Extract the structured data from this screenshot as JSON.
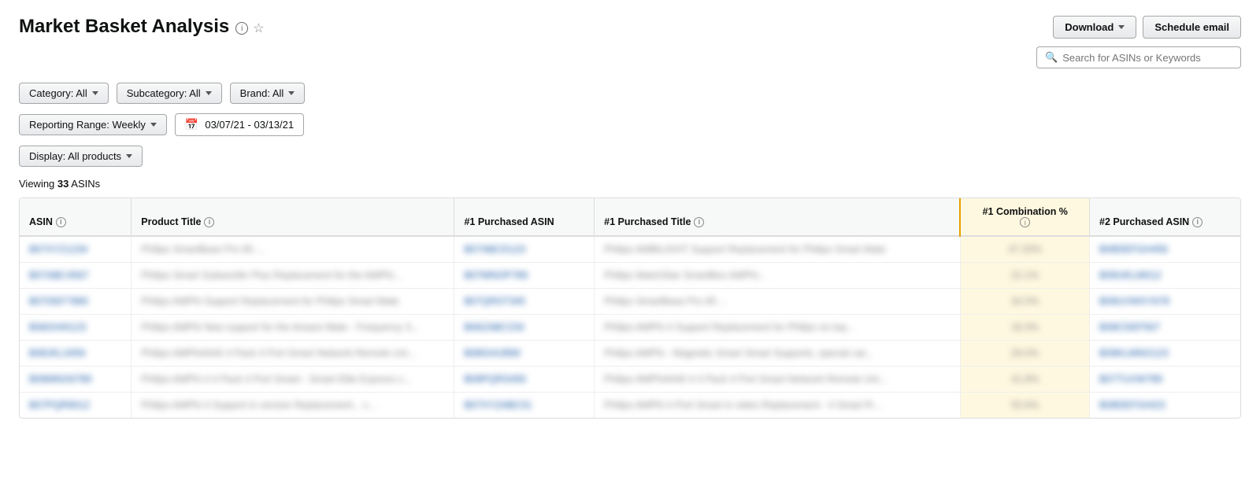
{
  "page": {
    "title": "Market Basket Analysis",
    "info_icon": "i",
    "star_icon": "☆"
  },
  "header": {
    "download_label": "Download",
    "schedule_email_label": "Schedule email",
    "search_placeholder": "Search for ASINs or Keywords"
  },
  "filters": {
    "category_label": "Category: All",
    "subcategory_label": "Subcategory: All",
    "brand_label": "Brand: All",
    "reporting_range_label": "Reporting Range: Weekly",
    "date_range": "03/07/21 - 03/13/21",
    "display_label": "Display: All products"
  },
  "table": {
    "viewing_text": "Viewing",
    "viewing_count": "33",
    "viewing_unit": "ASINs",
    "columns": [
      {
        "id": "asin",
        "label": "ASIN",
        "has_info": true
      },
      {
        "id": "product_title",
        "label": "Product Title",
        "has_info": true
      },
      {
        "id": "p1_asin",
        "label": "#1 Purchased ASIN",
        "has_info": false
      },
      {
        "id": "p1_title",
        "label": "#1 Purchased Title",
        "has_info": true
      },
      {
        "id": "p1_combo",
        "label": "#1 Combination %",
        "has_info": true
      },
      {
        "id": "p2_asin",
        "label": "#2 Purchased ASIN",
        "has_info": true
      }
    ],
    "rows": [
      {
        "asin": "B07XYZ1234",
        "product_title": "Philips SmartBase Pro 65 ...",
        "p1_asin": "B07ABCD123",
        "p1_title": "Philips AMBILIGHT Support Replacement for Philips Smart Mate",
        "p1_combo": "47.25%",
        "p2_asin": "B08DEFGH456"
      },
      {
        "asin": "B07ABC4567",
        "product_title": "Philips Smart Subwoofer Plus Replacement for the AMPhi...",
        "p1_asin": "B07MNOP789",
        "p1_title": "Philips MatchStar SmartBox AMPhi...",
        "p1_combo": "22.1%",
        "p2_asin": "B09IJKLM012"
      },
      {
        "asin": "B07DEF7890",
        "product_title": "Philips AMPhi Support Replacement for Philips Smart Mate",
        "p1_asin": "B07QRST345",
        "p1_title": "Philips SmartBase Pro 65 ...",
        "p1_combo": "34.5%",
        "p2_asin": "B09UVWXY678"
      },
      {
        "asin": "B06GHI0123",
        "product_title": "Philips AMPhi New support for the Amaze Mate - Frequency 3...",
        "p1_asin": "B06ZABC234",
        "p1_title": "Philips AMPhi 4 Support Replacement for Philips no top...",
        "p1_combo": "18.3%",
        "p2_asin": "B08CDEF567"
      },
      {
        "asin": "B08JKL3456",
        "product_title": "Philips AMPhi4440 4 Pack 4 Port Smart Network Remote Uni...",
        "p1_asin": "B08GHIJ890",
        "p1_title": "Philips AMPhi - Magnetic Smart Smart Supports, special cat...",
        "p1_combo": "29.0%",
        "p2_asin": "B09KLMNO123"
      },
      {
        "asin": "B09MNO6789",
        "product_title": "Philips AMPhi 4 4 Pack 4 Port Smart - Smart Elite Express c...",
        "p1_asin": "B09PQRS456",
        "p1_title": "Philips AMPhi4440 4 4 Pack 4 Port Smart Network Remote Uni...",
        "p1_combo": "41.8%",
        "p2_asin": "B07TUVW789"
      },
      {
        "asin": "B07PQR9012",
        "product_title": "Philips AMPhi 4 Support in version Replacement... c...",
        "p1_asin": "B07XYZABC01",
        "p1_title": "Philips AMPhi 4 Port Smart in video Replacement - 4 Smart R...",
        "p1_combo": "55.6%",
        "p2_asin": "B08DEFGHI23"
      }
    ]
  }
}
